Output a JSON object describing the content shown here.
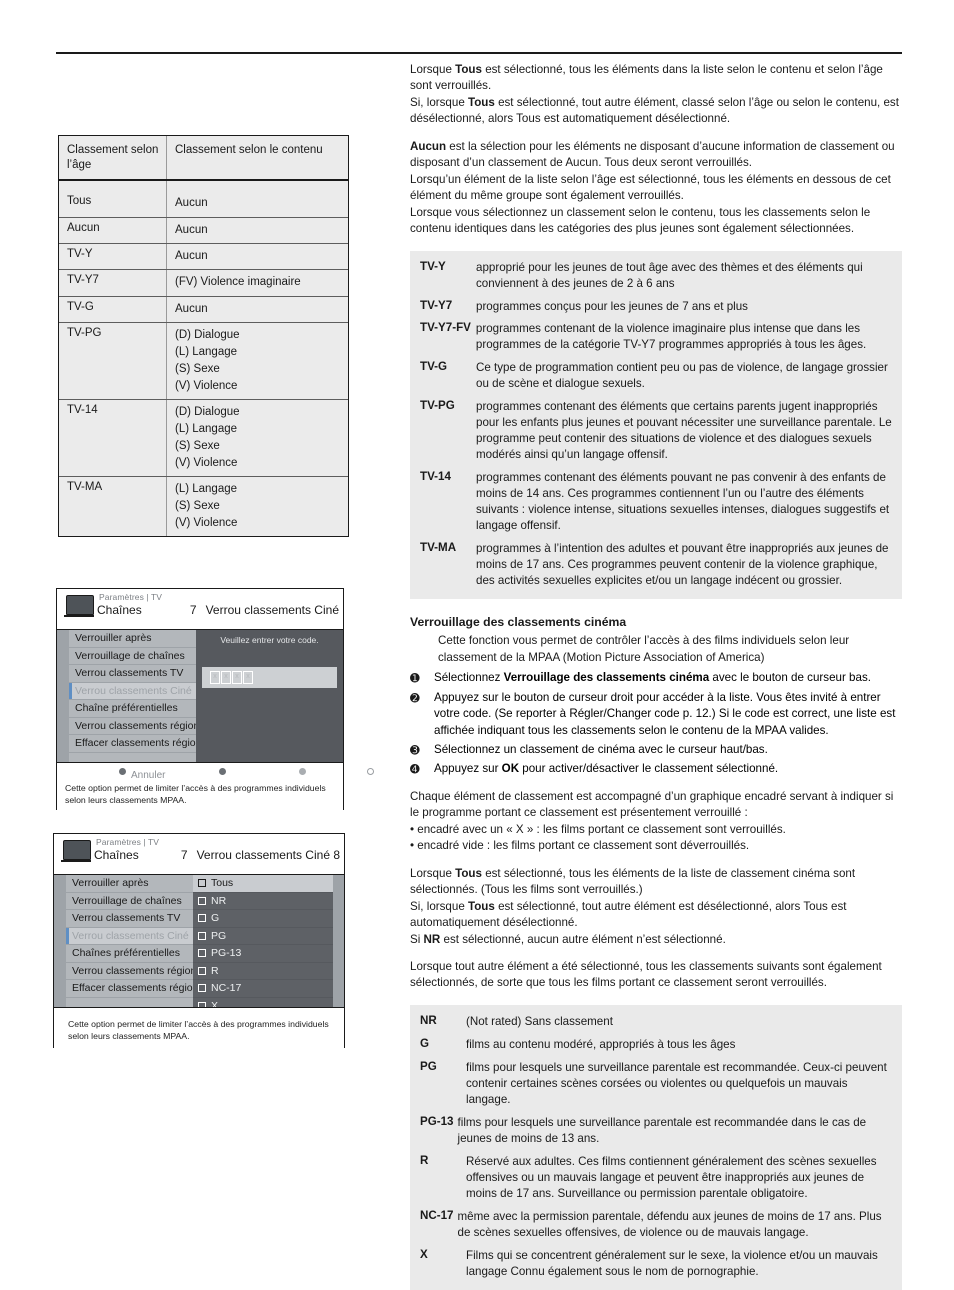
{
  "ratings_table": {
    "header": {
      "col1": "Classement selon l’âge",
      "col2": "Classement selon le contenu"
    },
    "rows": [
      {
        "age": "Tous",
        "content": [
          "Aucun"
        ]
      },
      {
        "age": "Aucun",
        "content": [
          "Aucun"
        ]
      },
      {
        "age": "TV-Y",
        "content": [
          "Aucun"
        ]
      },
      {
        "age": "TV-Y7",
        "content": [
          "(FV) Violence imaginaire"
        ]
      },
      {
        "age": "TV-G",
        "content": [
          "Aucun"
        ]
      },
      {
        "age": "TV-PG",
        "content": [
          "(D) Dialogue",
          "(L) Langage",
          "(S) Sexe",
          "(V) Violence"
        ]
      },
      {
        "age": "TV-14",
        "content": [
          "(D) Dialogue",
          "(L) Langage",
          "(S) Sexe",
          "(V) Violence"
        ]
      },
      {
        "age": "TV-MA",
        "content": [
          "(L) Langage",
          "(S) Sexe",
          "(V) Violence"
        ]
      }
    ]
  },
  "intro": {
    "p1_a": "Lorsque ",
    "p1_b": "Tous",
    "p1_c": " est sélectionné, tous les éléments dans la liste selon le contenu et selon l’âge sont verrouillés.",
    "p2_a": "Si, lorsque ",
    "p2_b": "Tous",
    "p2_c": " est sélectionné, tout autre élément, classé selon l’âge ou selon le contenu, est désélectionné, alors Tous est automatiquement désélectionné.",
    "p3_b": "Aucun",
    "p3_c": " est la sélection pour les éléments ne disposant d’aucune information de classement ou disposant d’un classement de Aucun. Tous deux seront verrouillés.",
    "p4": "Lorsqu’un élément de la liste selon l’âge est sélectionné, tous les éléments en dessous de cet élément du même groupe sont également verrouillés.",
    "p5": "Lorsque vous sélectionnez un classement selon le contenu, tous les classements selon le contenu identiques dans les catégories des plus jeunes sont également sélectionnées."
  },
  "tv_definitions": [
    {
      "term": "TV-Y",
      "desc": "approprié pour les jeunes de tout âge avec des thèmes et des éléments qui conviennent à des jeunes de 2 à 6 ans"
    },
    {
      "term": "TV-Y7",
      "desc": "programmes conçus pour les jeunes de 7 ans et plus"
    },
    {
      "term": "TV-Y7-FV",
      "desc": "programmes contenant de la violence imaginaire plus intense que dans les programmes de la catégorie TV-Y7 programmes appropriés à tous les âges.",
      "wide": true
    },
    {
      "term": "TV-G",
      "desc": "Ce type de programmation contient peu ou pas de violence, de langage grossier ou de scène et dialogue sexuels."
    },
    {
      "term": "TV-PG",
      "desc": "programmes contenant des éléments que certains parents jugent inappropriés pour les enfants plus jeunes et pouvant nécessiter une surveillance parentale. Le programme peut contenir des situations de violence et des dialogues sexuels modérés ainsi qu’un langage offensif."
    },
    {
      "term": "TV-14",
      "desc": "programmes contenant des éléments pouvant ne pas convenir à des enfants de moins de 14 ans. Ces programmes contiennent l’un ou l’autre des éléments suivants : violence intense, situations sexuelles intenses, dialogues suggestifs et langage offensif."
    },
    {
      "term": "TV-MA",
      "desc": "programmes à l’intention des adultes et pouvant être inappropriés aux jeunes de moins de 17 ans. Ces programmes peuvent contenir de la violence graphique, des activités sexuelles explicites et/ou un langage indécent ou grossier."
    }
  ],
  "movie_section": {
    "heading": "Verrouillage des classements cinéma",
    "lead": "Cette fonction vous permet de contrôler l’accès à des films individuels selon leur classement de la MPAA (Motion Picture Association of America)",
    "steps": [
      {
        "bullet": "➊",
        "pre": "Sélectionnez ",
        "bold": "Verrouillage des classements cinéma",
        "post": " avec le bouton de curseur bas."
      },
      {
        "bullet": "➋",
        "pre": "Appuyez sur le bouton de curseur droit pour accéder à la liste. Vous êtes invité à entrer votre code. (Se reporter à Régler/Changer code p. 12.) Si le code est correct, une liste est affichée indiquant tous les classements selon le contenu de la MPAA valides.",
        "bold": "",
        "post": ""
      },
      {
        "bullet": "➌",
        "pre": "Sélectionnez un classement de cinéma avec le curseur haut/bas.",
        "bold": "",
        "post": ""
      },
      {
        "bullet": "➍",
        "pre": "Appuyez sur ",
        "bold": "OK",
        "post": " pour activer/désactiver le classement sélectionné."
      }
    ],
    "p_graphic_1": "Chaque élément de classement est accompagné d’un graphique encadré servant à indiquer si le programme portant ce classement est présentement verrouillé :",
    "p_graphic_2": "• encadré avec un « X » : les films portant ce classement sont verrouillés.",
    "p_graphic_3": "• encadré vide : les films portant ce classement sont déverrouillés.",
    "p_tous_a": "Lorsque ",
    "p_tous_b": "Tous",
    "p_tous_c": " est sélectionné, tous les éléments de la liste de classement cinéma sont sélectionnés. (Tous les films sont verrouillés.)",
    "p_si_a": "Si, lorsque ",
    "p_si_b": "Tous",
    "p_si_c": " est sélectionné, tout autre élément est désélectionné, alors Tous est automatiquement désélectionné.",
    "p_nr_a": "Si ",
    "p_nr_b": "NR",
    "p_nr_c": " est sélectionné, aucun autre élément n’est sélectionné.",
    "p_final": "Lorsque tout autre élément a été sélectionné, tous les classements suivants sont également sélectionnés, de sorte que tous les films portant ce classement seront verrouillés."
  },
  "mpaa_definitions": [
    {
      "term": "NR",
      "desc": "(Not rated) Sans classement"
    },
    {
      "term": "G",
      "desc": "films au contenu modéré, appropriés à tous les âges"
    },
    {
      "term": "PG",
      "desc": "films pour lesquels une surveillance parentale est recommandée. Ceux-ci peuvent contenir certaines scènes corsées ou violentes ou quelquefois un mauvais langage."
    },
    {
      "term": "PG-13",
      "desc": "films pour lesquels une surveillance parentale est recommandée dans le cas de jeunes de moins de 13 ans.",
      "wide": true
    },
    {
      "term": "R",
      "desc": "Réservé aux adultes. Ces films contiennent généralement des scènes sexuelles offensives ou un mauvais langage et peuvent être inappropriés aux jeunes de moins de 17 ans. Surveillance ou permission parentale obligatoire."
    },
    {
      "term": "NC-17",
      "desc": "même avec la permission parentale, défendu aux jeunes de moins de 17 ans. Plus de scènes sexuelles offensives, de violence ou de mauvais langage.",
      "wide": true
    },
    {
      "term": "X",
      "desc": "Films qui se concentrent généralement sur le sexe, la violence et/ou un mauvais langage Connu également sous le nom de pornographie."
    }
  ],
  "tv_mockup_1": {
    "breadcrumb": "Paramètres | TV",
    "channels_label": "Chaînes",
    "channel_number": "7",
    "section_title": "Verrou classements Ciné",
    "menu": [
      "Verrouiller après",
      "Verrouillage de chaînes",
      "Verrou classements TV",
      "Verrou classements Ciné",
      "Chaîne préférentielles",
      "Verrou classements région",
      "Effacer classements région",
      ""
    ],
    "active_index": 3,
    "code_hint": "Veuillez entrer votre code.",
    "code_digits": [
      "x",
      "x",
      "x",
      "x"
    ],
    "cancel_label": "Annuler",
    "footnote": "Cette option permet de limiter l’accès à des programmes individuels selon leurs classements MPAA."
  },
  "tv_mockup_2": {
    "breadcrumb": "Paramètres | TV",
    "channels_label": "Chaînes",
    "channel_number": "7",
    "section_title": "Verrou classements Ciné 8",
    "menu": [
      "Verrouiller après",
      "Verrouillage de chaînes",
      "Verrou classements TV",
      "Verrou classements Ciné",
      "Chaînes préférentielles",
      "Verrou classements région",
      "Effacer classements région",
      ""
    ],
    "active_index": 3,
    "ratings": [
      "Tous",
      "NR",
      "G",
      "PG",
      "PG-13",
      "R",
      "NC-17",
      "X"
    ],
    "selected_index": 0,
    "footnote": "Cette option permet de limiter l’accès à des programmes individuels selon leurs classements MPAA."
  },
  "colors": {
    "grey_box": "#eaeaea",
    "tv_panel_dark": "#56595e",
    "tv_menu_grey": "#b3b7bb",
    "tv_rail_grey": "#9ea3a8",
    "highlight": "#c9ccd0",
    "accent_blue": "#5f8fc4"
  }
}
